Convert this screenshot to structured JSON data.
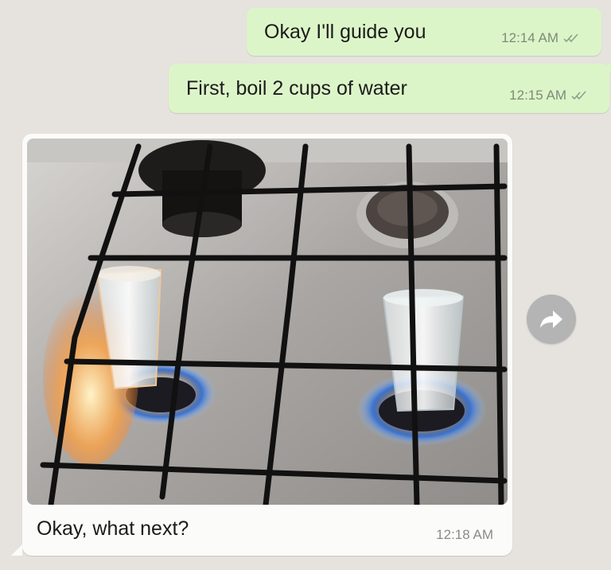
{
  "messages": [
    {
      "text": "Okay I'll guide you",
      "time": "12:14 AM",
      "status_icon": "double-check-icon"
    },
    {
      "text": "First, boil 2 cups of water",
      "time": "12:15 AM",
      "status_icon": "double-check-icon"
    }
  ],
  "reply": {
    "caption": "Okay, what next?",
    "time": "12:18 AM",
    "image_subject": "two glasses of water placed directly on lit gas stove burners"
  },
  "forward_icon": "forward-arrow-icon",
  "colors": {
    "outgoing_bubble": "#dcf5c8",
    "incoming_bubble": "#fbfbf9",
    "background": "#e6e2dd",
    "forward_button": "#b4b4b4"
  }
}
